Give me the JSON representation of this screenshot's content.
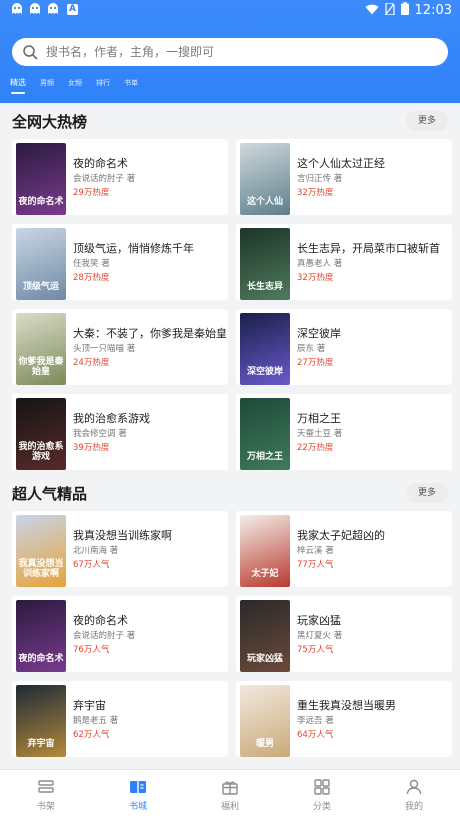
{
  "status": {
    "time": "12:03"
  },
  "search": {
    "placeholder": "搜书名，作者，主角，一搜即可"
  },
  "tabs": [
    {
      "label": "精选",
      "active": true
    },
    {
      "label": "男频"
    },
    {
      "label": "女频"
    },
    {
      "label": "排行"
    },
    {
      "label": "书单"
    }
  ],
  "sections": [
    {
      "title": "全网大热榜",
      "more": "更多",
      "books": [
        {
          "title": "夜的命名术",
          "author": "会说话的肘子 著",
          "stat": "29万热度",
          "cover_text": "夜的命名术",
          "cover_colors": [
            "#2b1b3f",
            "#7a3b8e"
          ]
        },
        {
          "title": "这个人仙太过正经",
          "author": "言归正传 著",
          "stat": "32万热度",
          "cover_text": "这个人仙",
          "cover_colors": [
            "#cfd8dc",
            "#5d7f8c"
          ]
        },
        {
          "title": "顶级气运，悄悄修炼千年",
          "author": "任我笑 著",
          "stat": "28万热度",
          "cover_text": "顶级气运",
          "cover_colors": [
            "#c9d6e3",
            "#6f8aa5"
          ]
        },
        {
          "title": "长生志异，开局菜市口被斩首",
          "author": "真愚老人 著",
          "stat": "32万热度",
          "cover_text": "长生志异",
          "cover_colors": [
            "#1d3528",
            "#4f7a5c"
          ]
        },
        {
          "title": "大秦：不装了，你爹我是秦始皇",
          "author": "头顶一只喵喵 著",
          "stat": "24万热度",
          "cover_text": "你爹我是秦始皇",
          "cover_colors": [
            "#d9dcc8",
            "#7d8a5a"
          ]
        },
        {
          "title": "深空彼岸",
          "author": "辰东 著",
          "stat": "27万热度",
          "cover_text": "深空彼岸",
          "cover_colors": [
            "#1a1f4a",
            "#6a5acd"
          ]
        },
        {
          "title": "我的治愈系游戏",
          "author": "我会修空调 著",
          "stat": "39万热度",
          "cover_text": "我的治愈系游戏",
          "cover_colors": [
            "#151515",
            "#5a2a2a"
          ]
        },
        {
          "title": "万相之王",
          "author": "天蚕土豆 著",
          "stat": "22万热度",
          "cover_text": "万相之王",
          "cover_colors": [
            "#1f4a3a",
            "#3f7a5a"
          ]
        }
      ]
    },
    {
      "title": "超人气精品",
      "more": "更多",
      "books": [
        {
          "title": "我真没想当训练家啊",
          "author": "北川南海 著",
          "stat": "67万人气",
          "cover_text": "我真没想当训练家啊",
          "cover_colors": [
            "#c8d4e8",
            "#e6a43a"
          ]
        },
        {
          "title": "我家太子妃超凶的",
          "author": "梓云溪 著",
          "stat": "77万人气",
          "cover_text": "太子妃",
          "cover_colors": [
            "#f3efe8",
            "#b8392f"
          ]
        },
        {
          "title": "夜的命名术",
          "author": "会说话的肘子 著",
          "stat": "76万人气",
          "cover_text": "夜的命名术",
          "cover_colors": [
            "#2b1b3f",
            "#7a3b8e"
          ]
        },
        {
          "title": "玩家凶猛",
          "author": "黑灯夏火 著",
          "stat": "75万人气",
          "cover_text": "玩家凶猛",
          "cover_colors": [
            "#2a2a2a",
            "#6b4a3a"
          ]
        },
        {
          "title": "弃宇宙",
          "author": "鹅是老五 著",
          "stat": "62万人气",
          "cover_text": "弃宇宙",
          "cover_colors": [
            "#1e2a38",
            "#b48a3a"
          ]
        },
        {
          "title": "重生我真没想当暖男",
          "author": "李远吾 著",
          "stat": "64万人气",
          "cover_text": "暖男",
          "cover_colors": [
            "#f1e9dd",
            "#c9a97a"
          ]
        }
      ]
    }
  ],
  "bottom_nav": [
    {
      "label": "书架",
      "icon": "bookshelf-icon"
    },
    {
      "label": "书城",
      "icon": "bookstore-icon",
      "active": true
    },
    {
      "label": "福利",
      "icon": "gift-icon"
    },
    {
      "label": "分类",
      "icon": "category-icon"
    },
    {
      "label": "我的",
      "icon": "profile-icon"
    }
  ],
  "colors": {
    "primary": "#2f82f8",
    "heat": "#e8412c"
  }
}
